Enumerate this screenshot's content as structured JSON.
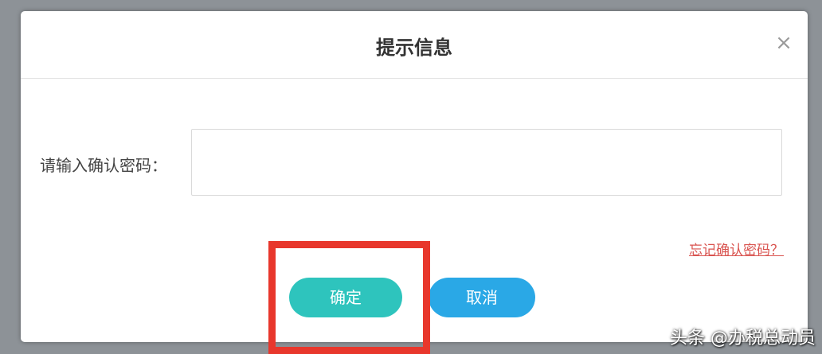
{
  "dialog": {
    "title": "提示信息",
    "close_label": "×",
    "field_label": "请输入确认密码：",
    "password_value": "",
    "forgot_link": "忘记确认密码？",
    "confirm_label": "确定",
    "cancel_label": "取消"
  },
  "watermark": "头条 @办税总动员",
  "colors": {
    "confirm": "#2ec4bd",
    "cancel": "#2aa8e6",
    "highlight": "#e8372c",
    "link": "#d9534f"
  }
}
